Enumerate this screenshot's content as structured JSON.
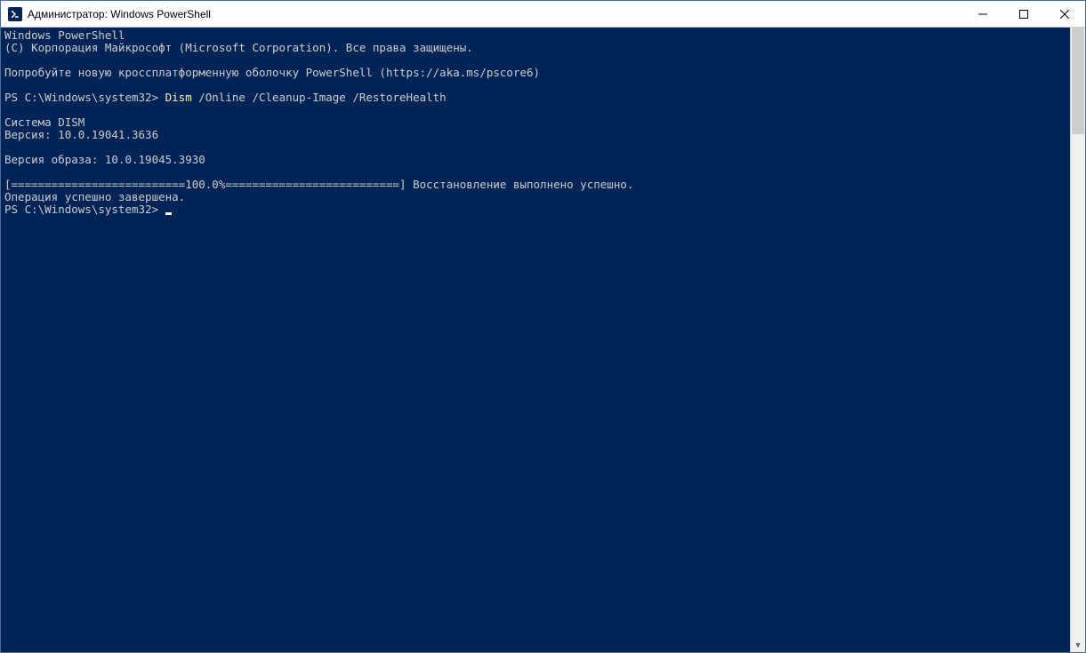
{
  "titlebar": {
    "title": "Администратор: Windows PowerShell"
  },
  "terminal": {
    "line_app": "Windows PowerShell",
    "line_copyright": "(C) Корпорация Майкрософт (Microsoft Corporation). Все права защищены.",
    "line_try": "Попробуйте новую кроссплатформенную оболочку PowerShell (https://aka.ms/pscore6)",
    "prompt1_prefix": "PS C:\\Windows\\system32> ",
    "prompt1_cmd_hl": "Dism",
    "prompt1_cmd_rest": " /Online /Cleanup-Image /RestoreHealth",
    "line_dism_system": "Cистема DISM",
    "line_dism_version": "Версия: 10.0.19041.3636",
    "line_image_version": "Версия образа: 10.0.19045.3930",
    "line_progress": "[==========================100.0%==========================] Восстановление выполнено успешно.",
    "line_done": "Операция успешно завершена.",
    "prompt2": "PS C:\\Windows\\system32> "
  }
}
